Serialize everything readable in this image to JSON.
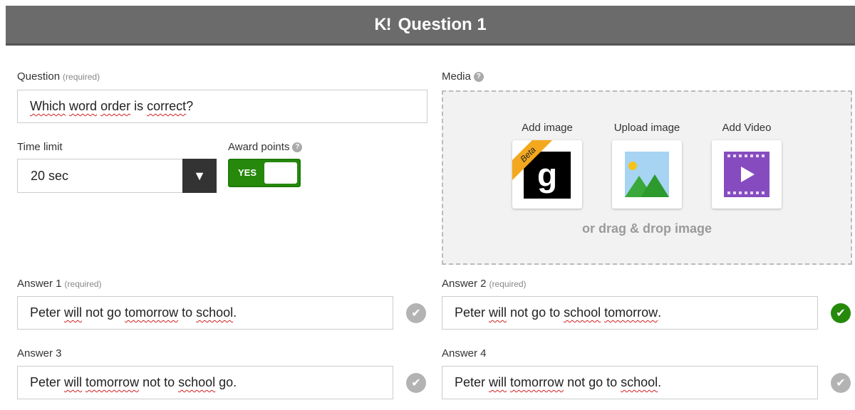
{
  "header": {
    "logo": "K!",
    "title": "Question 1"
  },
  "question": {
    "label": "Question",
    "required": "(required)",
    "words": [
      {
        "t": "Which",
        "spell": true
      },
      {
        "t": " "
      },
      {
        "t": "word",
        "spell": true
      },
      {
        "t": " "
      },
      {
        "t": "order",
        "spell": true
      },
      {
        "t": " is "
      },
      {
        "t": "correct",
        "spell": true
      },
      {
        "t": "?"
      }
    ]
  },
  "time_limit": {
    "label": "Time limit",
    "value": "20 sec",
    "arrow": "▼"
  },
  "award_points": {
    "label": "Award points",
    "help": "?",
    "toggle_label": "YES",
    "on": true
  },
  "media": {
    "label": "Media",
    "help": "?",
    "options": [
      {
        "label": "Add image",
        "icon": "getty-images-icon",
        "letter": "g",
        "badge": "Beta"
      },
      {
        "label": "Upload image",
        "icon": "image-upload-icon"
      },
      {
        "label": "Add Video",
        "icon": "video-icon"
      }
    ],
    "drag_text": "or drag & drop image"
  },
  "answers": [
    {
      "label": "Answer 1",
      "required": "(required)",
      "correct": false,
      "check": "✔",
      "words": [
        {
          "t": "Peter "
        },
        {
          "t": "will",
          "spell": true
        },
        {
          "t": " not go "
        },
        {
          "t": "tomorrow",
          "spell": true
        },
        {
          "t": " to "
        },
        {
          "t": "school",
          "spell": true
        },
        {
          "t": "."
        }
      ]
    },
    {
      "label": "Answer 2",
      "required": "(required)",
      "correct": true,
      "check": "✔",
      "words": [
        {
          "t": "Peter "
        },
        {
          "t": "will",
          "spell": true
        },
        {
          "t": " not go to "
        },
        {
          "t": "school",
          "spell": true
        },
        {
          "t": " "
        },
        {
          "t": "tomorrow",
          "spell": true
        },
        {
          "t": "."
        }
      ]
    },
    {
      "label": "Answer 3",
      "required": "",
      "correct": false,
      "check": "✔",
      "words": [
        {
          "t": "Peter "
        },
        {
          "t": "will",
          "spell": true
        },
        {
          "t": " "
        },
        {
          "t": "tomorrow",
          "spell": true
        },
        {
          "t": " not to "
        },
        {
          "t": "school",
          "spell": true
        },
        {
          "t": " go."
        }
      ]
    },
    {
      "label": "Answer 4",
      "required": "",
      "correct": false,
      "check": "✔",
      "words": [
        {
          "t": "Peter "
        },
        {
          "t": "will",
          "spell": true
        },
        {
          "t": " "
        },
        {
          "t": "tomorrow",
          "spell": true
        },
        {
          "t": " not go to "
        },
        {
          "t": "school",
          "spell": true
        },
        {
          "t": "."
        }
      ]
    }
  ],
  "colors": {
    "header_bg": "#6b6b6b",
    "correct_green": "#26890c",
    "check_gray": "#b3b3b3",
    "beta_orange": "#f4a81d",
    "video_purple": "#864cbf"
  }
}
